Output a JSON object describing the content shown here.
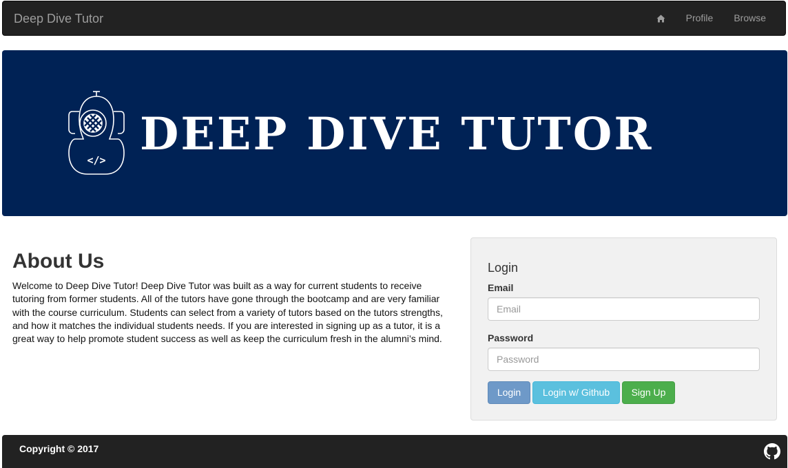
{
  "navbar": {
    "brand": "Deep Dive Tutor",
    "items": [
      {
        "icon": "home-icon",
        "label": ""
      },
      {
        "label": "Profile"
      },
      {
        "label": "Browse"
      }
    ]
  },
  "banner": {
    "logo_icon": "diving-helmet-icon",
    "logo_code_glyph": "</>",
    "title": "DEEP DIVE TUTOR",
    "background_color": "#002255"
  },
  "about": {
    "title": "About Us",
    "text": "Welcome to Deep Dive Tutor! Deep Dive Tutor was built as a way for current students to receive tutoring from former students. All of the tutors have gone through the bootcamp and are very familiar with the course curriculum. Students can select from a variety of tutors based on the tutors strengths, and how it matches the individual students needs. If you are interested in signing up as a tutor, it is a great way to help promote student success as well as keep the curriculum fresh in the alumni’s mind."
  },
  "login": {
    "title": "Login",
    "email_label": "Email",
    "email_placeholder": "Email",
    "email_value": "",
    "password_label": "Password",
    "password_placeholder": "Password",
    "password_value": "",
    "buttons": {
      "login": "Login",
      "github": "Login w/ Github",
      "signup": "Sign Up"
    }
  },
  "footer": {
    "copyright": "Copyright © 2017",
    "icon": "github-icon"
  },
  "colors": {
    "navbar_bg": "#222222",
    "banner_bg": "#002255",
    "btn_login": "#6e99c8",
    "btn_github": "#5bc0de",
    "btn_signup": "#4cae4c"
  }
}
